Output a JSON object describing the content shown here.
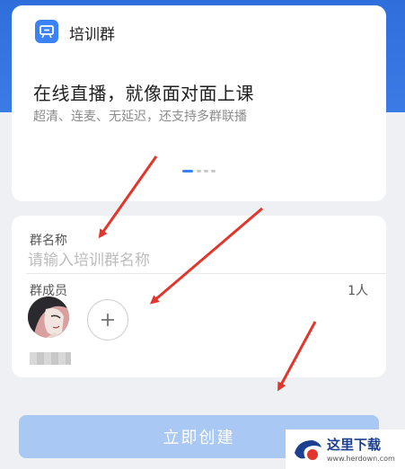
{
  "intro": {
    "title": "培训群",
    "headline": "在线直播，就像面对面上课",
    "subtitle": "超清、连麦、无延迟，还支持多群联播"
  },
  "form": {
    "name_label": "群名称",
    "name_placeholder": "请输入培训群名称",
    "name_value": "",
    "members_label": "群成员",
    "member_count": "1人"
  },
  "actions": {
    "create_label": "立即创建"
  },
  "watermark": {
    "text": "这里下载",
    "url": "www.herdown.com"
  },
  "colors": {
    "accent": "#3b82f6",
    "button_disabled": "#a9c8f3",
    "annotation_arrow": "#e0362c"
  }
}
